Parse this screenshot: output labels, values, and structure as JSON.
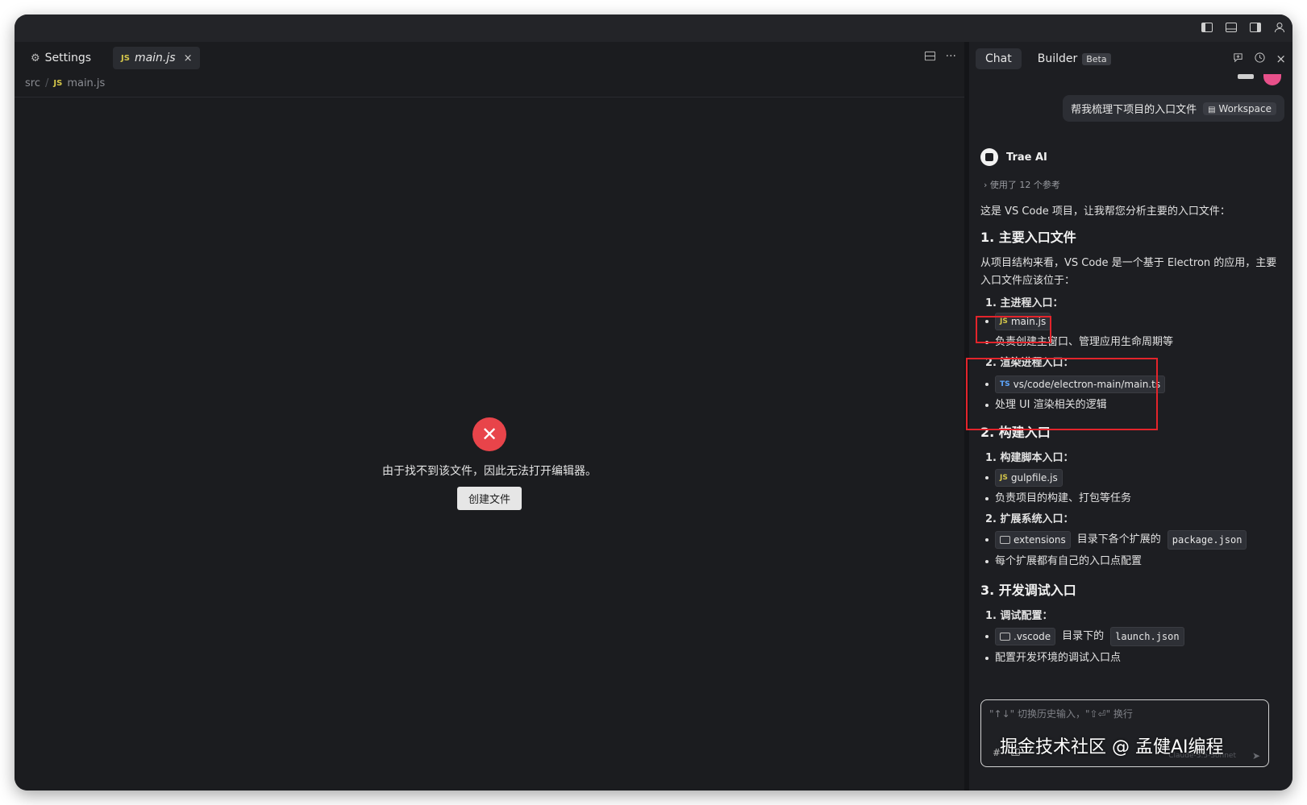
{
  "editor": {
    "tabs": [
      {
        "label": "Settings"
      },
      {
        "label": "main.js",
        "lang": "JS",
        "close": "×"
      }
    ],
    "actions": {
      "more": "···"
    },
    "breadcrumb": {
      "folder": "src",
      "sep": "/",
      "lang": "JS",
      "file": "main.js"
    },
    "error": {
      "icon": "✕",
      "message": "由于找不到该文件，因此无法打开编辑器。",
      "button": "创建文件"
    }
  },
  "chat": {
    "tabs": {
      "chat": "Chat",
      "builder": "Builder",
      "beta": "Beta"
    },
    "close": "×",
    "user_message": {
      "text": "帮我梳理下项目的入口文件",
      "chip": "Workspace"
    },
    "ai": {
      "name": "Trae AI",
      "refs": "使用了 12 个参考",
      "intro": "这是 VS Code 项目，让我帮您分析主要的入口文件：",
      "s1_title": "1. 主要入口文件",
      "s1_desc": "从项目结构来看，VS Code 是一个基于 Electron 的应用，主要入口文件应该位于：",
      "s1_i1": "1. 主进程入口：",
      "s1_i1_file_lang": "JS",
      "s1_i1_file": "main.js",
      "s1_i1_desc": "负责创建主窗口、管理应用生命周期等",
      "s1_i2": "2. 渲染进程入口：",
      "s1_i2_file_lang": "TS",
      "s1_i2_file": "vs/code/electron-main/main.ts",
      "s1_i2_desc": "处理 UI 渲染相关的逻辑",
      "s2_title": "2. 构建入口",
      "s2_i1": "1. 构建脚本入口：",
      "s2_i1_file_lang": "JS",
      "s2_i1_file": "gulpfile.js",
      "s2_i1_desc": "负责项目的构建、打包等任务",
      "s2_i2": "2. 扩展系统入口：",
      "s2_i2_folder": "extensions",
      "s2_i2_mid": "目录下各个扩展的",
      "s2_i2_code": "package.json",
      "s2_i2_desc": "每个扩展都有自己的入口点配置",
      "s3_title": "3. 开发调试入口",
      "s3_i1": "1. 调试配置：",
      "s3_i1_folder": ".vscode",
      "s3_i1_mid": "目录下的",
      "s3_i1_code": "launch.json",
      "s3_i1_desc": "配置开发环境的调试入口点"
    },
    "input": {
      "placeholder": "\"↑↓\" 切换历史输入，\"⇧⏎\" 换行",
      "hash": "#",
      "model": "Claude-3.5-Sonnet"
    }
  },
  "watermark": "掘金技术社区 @ 孟健AI编程",
  "colors": {
    "error": "#e8444a",
    "highlight": "#e3242b",
    "js": "#d4c64a",
    "ts": "#5ea7ff"
  }
}
